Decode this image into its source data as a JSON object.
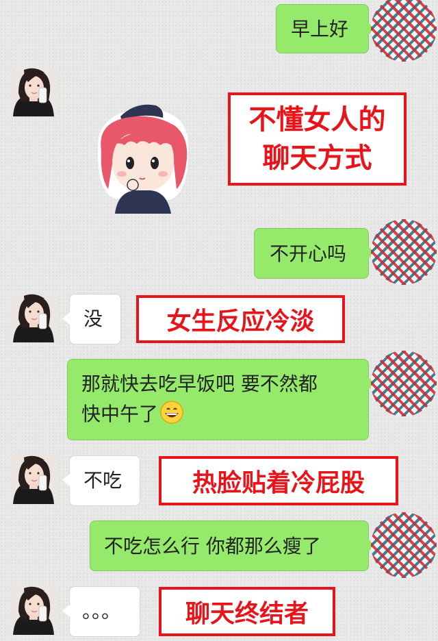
{
  "chat": {
    "messages": [
      {
        "id": "m1",
        "side": "self",
        "text": "早上好"
      },
      {
        "id": "m2",
        "side": "other",
        "type": "sticker",
        "sticker": "girl-sticker"
      },
      {
        "id": "m3",
        "side": "self",
        "text": "不开心吗"
      },
      {
        "id": "m4",
        "side": "other",
        "text": "没"
      },
      {
        "id": "m5",
        "side": "self",
        "line1": "那就快去吃早饭吧  要不然都",
        "line2": "快中午了",
        "emoji": "grinning-face-emoji"
      },
      {
        "id": "m6",
        "side": "other",
        "text": "不吃"
      },
      {
        "id": "m7",
        "side": "self",
        "text": "不吃怎么行  你都那么瘦了"
      },
      {
        "id": "m8",
        "side": "other",
        "text": "。。。"
      }
    ]
  },
  "captions": {
    "c1_line1": "不懂女人的",
    "c1_line2": "聊天方式",
    "c2": "女生反应冷淡",
    "c3": "热脸贴着冷屁股",
    "c4": "聊天终结者"
  },
  "colors": {
    "self_bubble": "#95ea6b",
    "other_bubble": "#ffffff",
    "caption_red": "#e8141a",
    "background": "#e8e8e8"
  },
  "icons": {
    "self_avatar": "checkered-pattern-avatar",
    "other_avatar": "girl-photo-avatar"
  }
}
